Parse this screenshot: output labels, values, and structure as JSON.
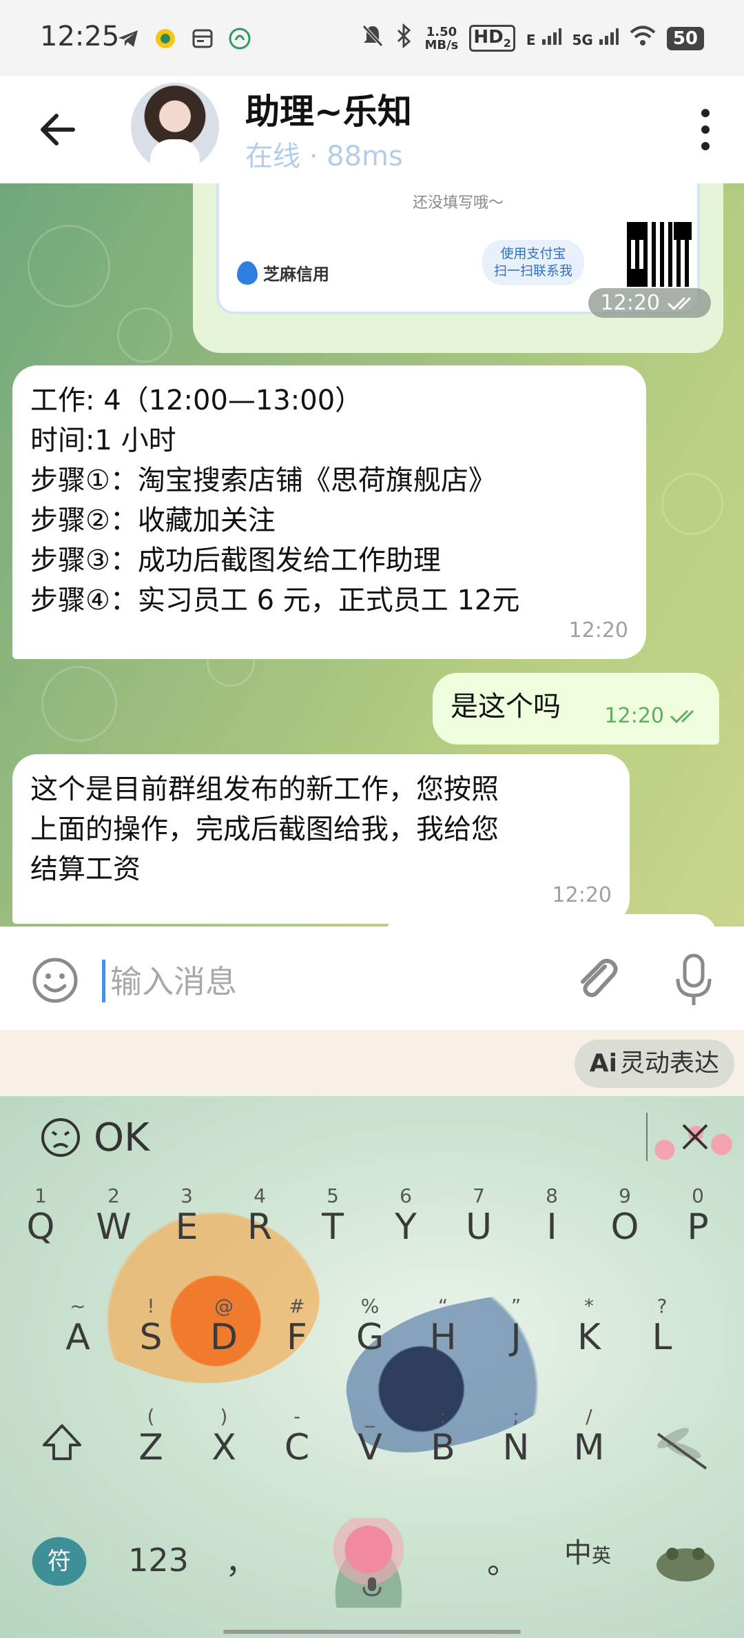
{
  "status_bar": {
    "time": "12:25",
    "network_speed_value": "1.50",
    "network_speed_unit": "MB/s",
    "hd_label": "HD",
    "hd_sub": "2",
    "net_e": "E",
    "net_5g": "5G",
    "battery": "50"
  },
  "header": {
    "title": "助理~乐知",
    "subtitle": "在线 · 88ms"
  },
  "card": {
    "note": "还没填写哦～",
    "brand": "芝麻信用",
    "alipay_line1": "使用支付宝",
    "alipay_line2": "扫一扫联系我",
    "time": "12:20"
  },
  "messages": [
    {
      "direction": "incoming",
      "lines": [
        "工作: 4（12:00—13:00）",
        "时间:1 小时",
        "步骤①：淘宝搜索店铺《思荷旗舰店》",
        "步骤②：收藏加关注",
        "步骤③：成功后截图发给工作助理",
        "步骤④：实习员工 6 元，正式员工 12元"
      ],
      "time": "12:20"
    },
    {
      "direction": "outgoing",
      "text": "是这个吗",
      "time": "12:20"
    },
    {
      "direction": "incoming",
      "lines": [
        "这个是目前群组发布的新工作，您按照",
        "上面的操作，完成后截图给我，我给您",
        "结算工资"
      ],
      "time": "12:20"
    }
  ],
  "input": {
    "placeholder": "输入消息"
  },
  "keyboard": {
    "ai_label_prefix": "Ai",
    "ai_label": "灵动表达",
    "suggestion": "OK",
    "row1": [
      {
        "hint": "1",
        "key": "Q"
      },
      {
        "hint": "2",
        "key": "W"
      },
      {
        "hint": "3",
        "key": "E"
      },
      {
        "hint": "4",
        "key": "R"
      },
      {
        "hint": "5",
        "key": "T"
      },
      {
        "hint": "6",
        "key": "Y"
      },
      {
        "hint": "7",
        "key": "U"
      },
      {
        "hint": "8",
        "key": "I"
      },
      {
        "hint": "9",
        "key": "O"
      },
      {
        "hint": "0",
        "key": "P"
      }
    ],
    "row2": [
      {
        "hint": "~",
        "key": "A"
      },
      {
        "hint": "!",
        "key": "S"
      },
      {
        "hint": "@",
        "key": "D"
      },
      {
        "hint": "#",
        "key": "F"
      },
      {
        "hint": "%",
        "key": "G"
      },
      {
        "hint": "“",
        "key": "H"
      },
      {
        "hint": "”",
        "key": "J"
      },
      {
        "hint": "*",
        "key": "K"
      },
      {
        "hint": "?",
        "key": "L"
      }
    ],
    "row3": [
      {
        "hint": "(",
        "key": "Z"
      },
      {
        "hint": ")",
        "key": "X"
      },
      {
        "hint": "-",
        "key": "C"
      },
      {
        "hint": "_",
        "key": "V"
      },
      {
        "hint": ":",
        "key": "B"
      },
      {
        "hint": ";",
        "key": "N"
      },
      {
        "hint": "/",
        "key": "M"
      }
    ],
    "symbols_key": "符",
    "numbers_key": "123",
    "comma_key": "，",
    "period_key": "。",
    "lang_key_main": "中",
    "lang_key_sub": "英"
  }
}
